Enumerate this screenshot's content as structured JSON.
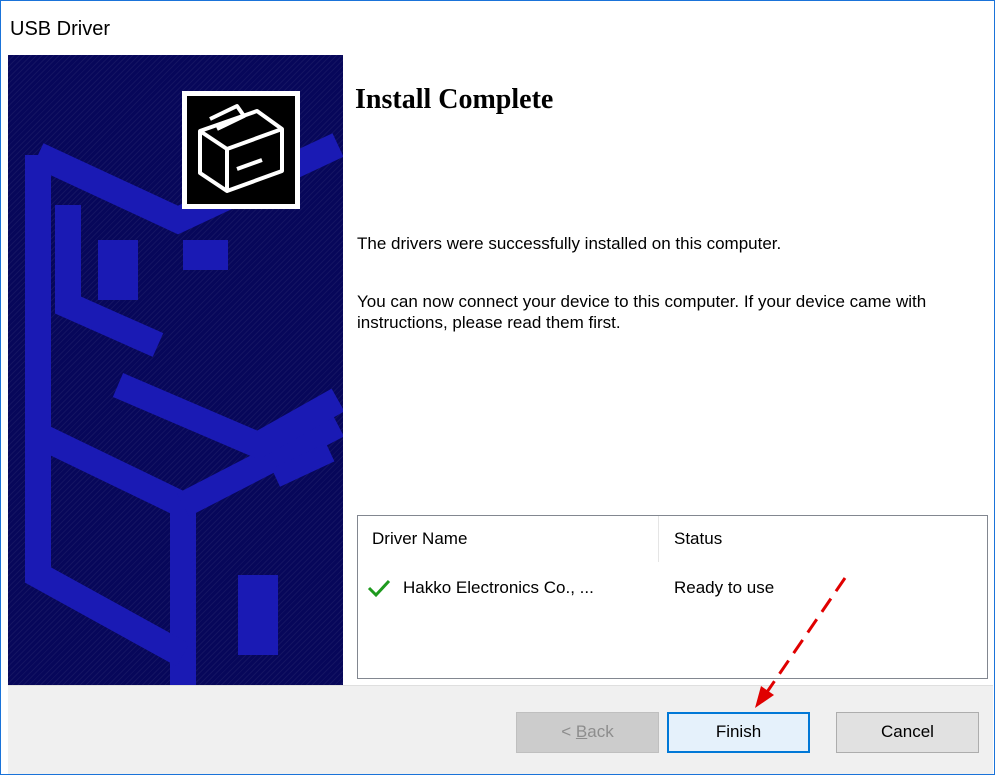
{
  "window": {
    "title": "USB Driver"
  },
  "header": {
    "title": "Install Complete"
  },
  "messages": {
    "success": "The drivers were successfully installed on this computer.",
    "instructions": "You can now connect your device to this computer. If your device came with instructions, please read them first."
  },
  "driver_table": {
    "columns": [
      "Driver Name",
      "Status"
    ],
    "rows": [
      {
        "icon": "checkmark-icon",
        "name": "Hakko Electronics Co., ...",
        "status": "Ready to use"
      }
    ]
  },
  "buttons": {
    "back_prefix": "< ",
    "back_accel": "B",
    "back_rest": "ack",
    "finish": "Finish",
    "cancel": "Cancel"
  },
  "colors": {
    "banner": "#07075a",
    "focus_border": "#0078d7",
    "check": "#1e9a1e",
    "annotation_arrow": "#e00000"
  },
  "icons": {
    "driver": "driver-box-icon",
    "check": "checkmark-icon",
    "annotation": "red-dashed-arrow-icon"
  }
}
